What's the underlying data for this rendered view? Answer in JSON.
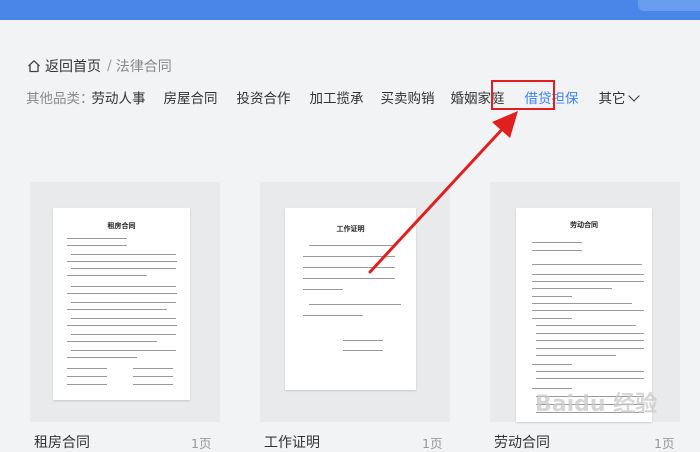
{
  "breadcrumb": {
    "home_label": "返回首页",
    "separator": "/",
    "current": "法律合同"
  },
  "categories": {
    "label": "其他品类：",
    "items": [
      "劳动人事",
      "房屋合同",
      "投资合作",
      "加工揽承",
      "买卖购销",
      "婚姻家庭",
      "借贷担保",
      "其它"
    ],
    "active": "借贷担保"
  },
  "cards": [
    {
      "title": "租房合同",
      "pages": "1页",
      "doc_heading": "租房合同"
    },
    {
      "title": "工作证明",
      "pages": "1页",
      "doc_heading": "工作证明"
    },
    {
      "title": "劳动合同",
      "pages": "1页",
      "doc_heading": "劳动合同"
    }
  ],
  "watermark": "Baidu 经验",
  "colors": {
    "topbar": "#4a86e8",
    "active_category": "#3b82f6",
    "highlight_box": "#e02020",
    "arrow": "#e02020"
  }
}
